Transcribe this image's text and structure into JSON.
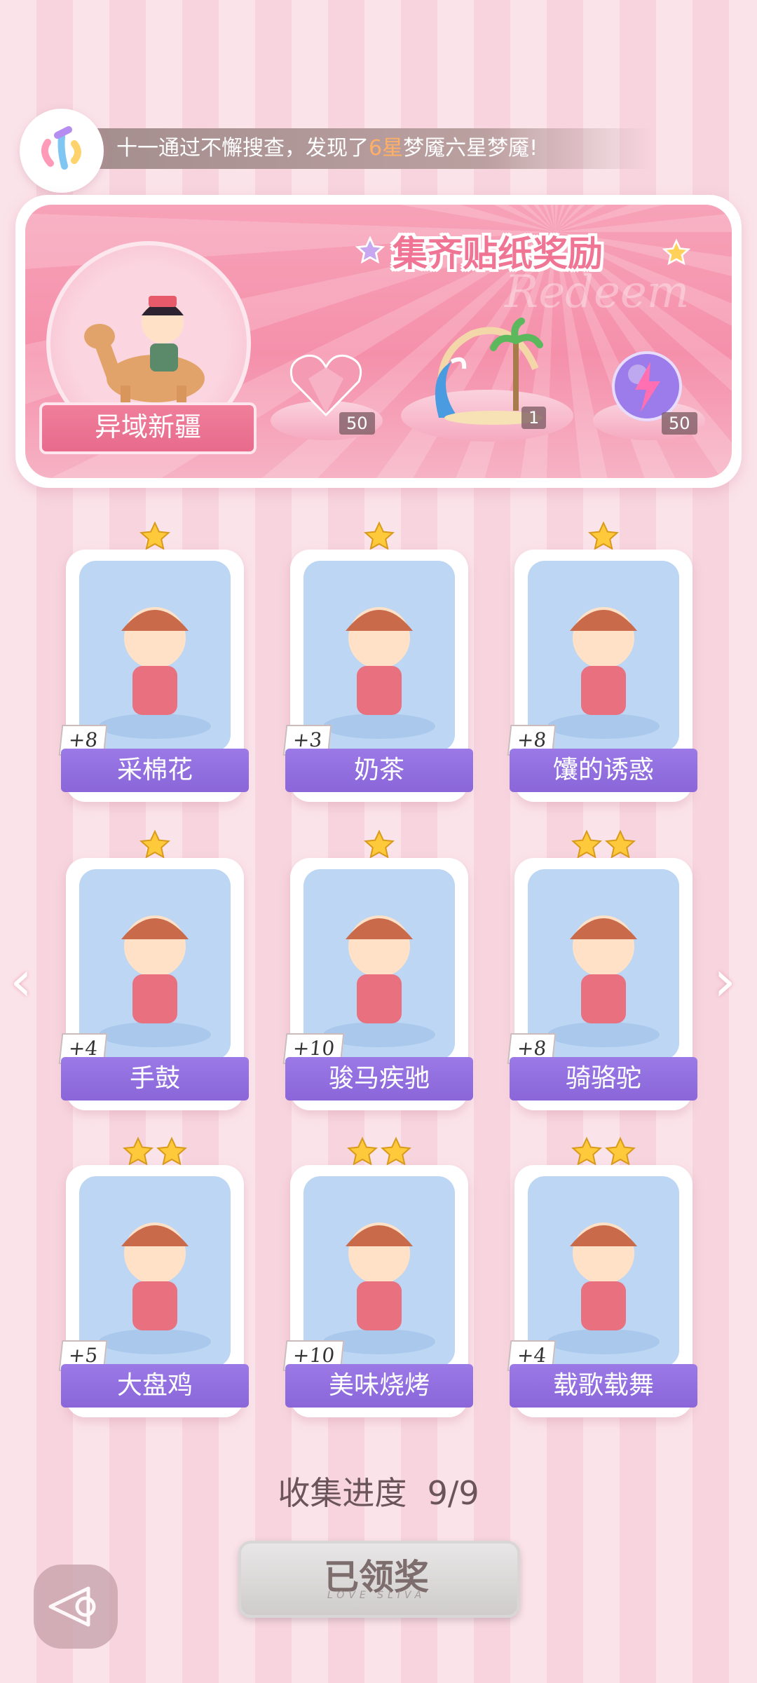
{
  "notification": {
    "text_before": "十一通过不懈搜查，发现了",
    "highlight": "6星",
    "text_after": "梦魇六星梦魇!"
  },
  "banner": {
    "title": "集齐贴纸奖励",
    "watermark": "Redeem",
    "region": "异域新疆",
    "rewards": [
      {
        "icon": "pink-heart-gem-icon",
        "qty": "50"
      },
      {
        "icon": "beach-arch-decoration-icon",
        "qty": "1"
      },
      {
        "icon": "purple-lightning-orb-icon",
        "qty": "50"
      }
    ]
  },
  "cards": [
    {
      "label": "采棉花",
      "points": "+8",
      "stars": 1
    },
    {
      "label": "奶茶",
      "points": "+3",
      "stars": 1
    },
    {
      "label": "馕的诱惑",
      "points": "+8",
      "stars": 1
    },
    {
      "label": "手鼓",
      "points": "+4",
      "stars": 1
    },
    {
      "label": "骏马疾驰",
      "points": "+10",
      "stars": 1
    },
    {
      "label": "骑骆驼",
      "points": "+8",
      "stars": 2
    },
    {
      "label": "大盘鸡",
      "points": "+5",
      "stars": 2
    },
    {
      "label": "美味烧烤",
      "points": "+10",
      "stars": 2
    },
    {
      "label": "载歌载舞",
      "points": "+4",
      "stars": 2
    }
  ],
  "progress": {
    "label": "收集进度",
    "value": "9/9"
  },
  "claim_button": {
    "label": "已领奖",
    "subtitle": "LOVE SLIVA"
  },
  "colors": {
    "accent_purple": "#8a66d9",
    "banner_pink": "#f590ab",
    "card_bg": "#bcd6f3"
  }
}
